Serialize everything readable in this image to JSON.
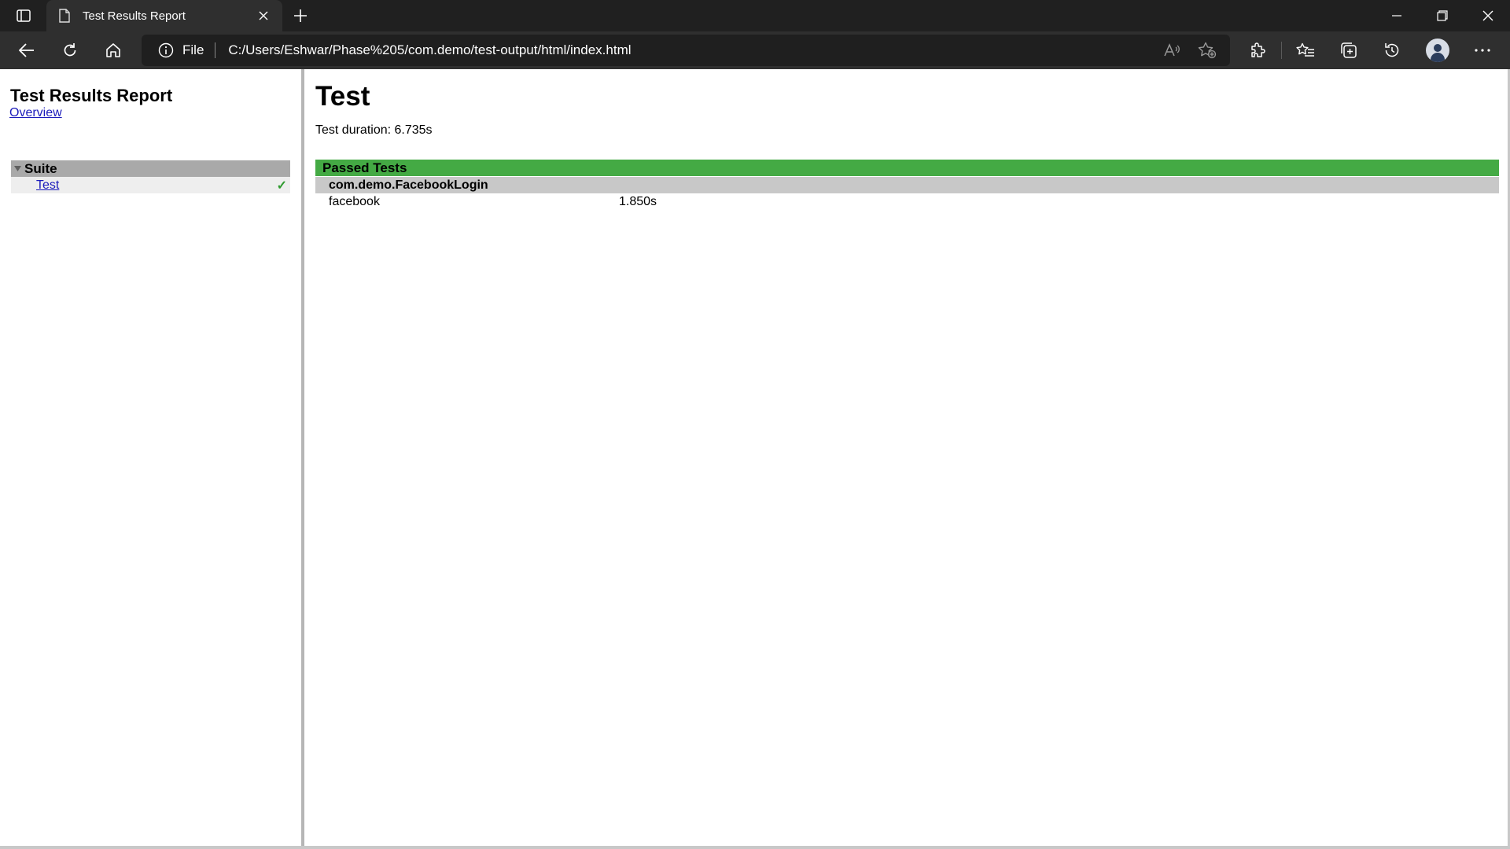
{
  "browser": {
    "tab_title": "Test Results Report",
    "address_scheme": "File",
    "address_url": "C:/Users/Eshwar/Phase%205/com.demo/test-output/html/index.html",
    "theme_color": "#202020"
  },
  "sidebar": {
    "title": "Test Results Report",
    "overview_link": "Overview",
    "suite": {
      "label": "Suite",
      "tests": [
        {
          "label": "Test",
          "status": "passed",
          "status_icon": "checkmark-icon"
        }
      ]
    }
  },
  "main": {
    "title": "Test",
    "duration": "Test duration: 6.735s",
    "sections": [
      {
        "label": "Passed Tests",
        "color": "#44aa44",
        "classes": [
          {
            "name": "com.demo.FacebookLogin",
            "methods": [
              {
                "name": "facebook",
                "duration": "1.850s"
              }
            ]
          }
        ]
      }
    ]
  }
}
